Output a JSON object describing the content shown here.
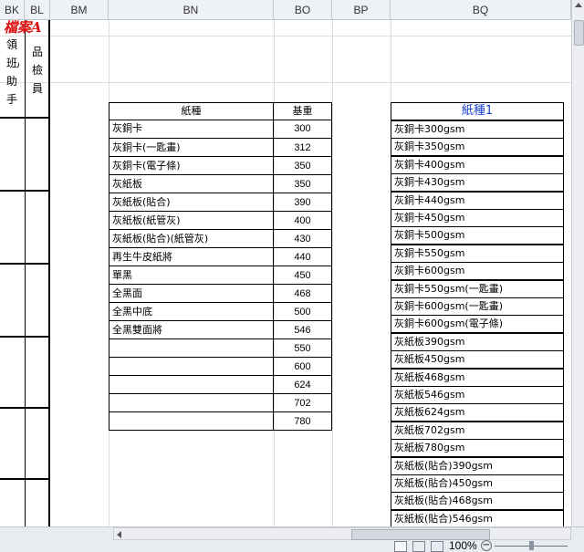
{
  "columns": [
    "BK",
    "BL",
    "BM",
    "BN",
    "BO",
    "BP",
    "BQ"
  ],
  "stamp": "檔案A",
  "bk_header": "領班/助手",
  "bl_header": "品檢員",
  "table1": {
    "header_type": "紙種",
    "header_weight": "基重",
    "types": [
      "灰銅卡",
      "灰銅卡(一匙畫)",
      "灰銅卡(電子條)",
      "灰紙板",
      "灰紙板(貼合)",
      "灰紙板(紙管灰)",
      "灰紙板(貼合)(紙管灰)",
      "再生牛皮紙將",
      "單黑",
      "全黑面",
      "全黑中底",
      "全黑雙面將",
      "",
      "",
      "",
      ""
    ],
    "weights": [
      "300",
      "312",
      "350",
      "350",
      "390",
      "400",
      "430",
      "440",
      "450",
      "468",
      "500",
      "546",
      "550",
      "600",
      "624",
      "702",
      "780"
    ]
  },
  "table2": {
    "header": "紙種1",
    "items": [
      "灰銅卡300gsm",
      "灰銅卡350gsm",
      "灰銅卡400gsm",
      "灰銅卡430gsm",
      "灰銅卡440gsm",
      "灰銅卡450gsm",
      "灰銅卡500gsm",
      "灰銅卡550gsm",
      "灰銅卡600gsm",
      "灰銅卡550gsm(一匙畫)",
      "灰銅卡600gsm(一匙畫)",
      "灰銅卡600gsm(電子條)",
      "灰紙板390gsm",
      "灰紙板450gsm",
      "灰紙板468gsm",
      "灰紙板546gsm",
      "灰紙板624gsm",
      "灰紙板702gsm",
      "灰紙板780gsm",
      "灰紙板(貼合)390gsm",
      "灰紙板(貼合)450gsm",
      "灰紙板(貼合)468gsm",
      "灰紙板(貼合)546gsm"
    ]
  },
  "status": {
    "zoom": "100%"
  },
  "colors": {
    "header_bg": "#eef1f6",
    "stamp": "#e01010",
    "blue_header": "#1a3fd0"
  }
}
